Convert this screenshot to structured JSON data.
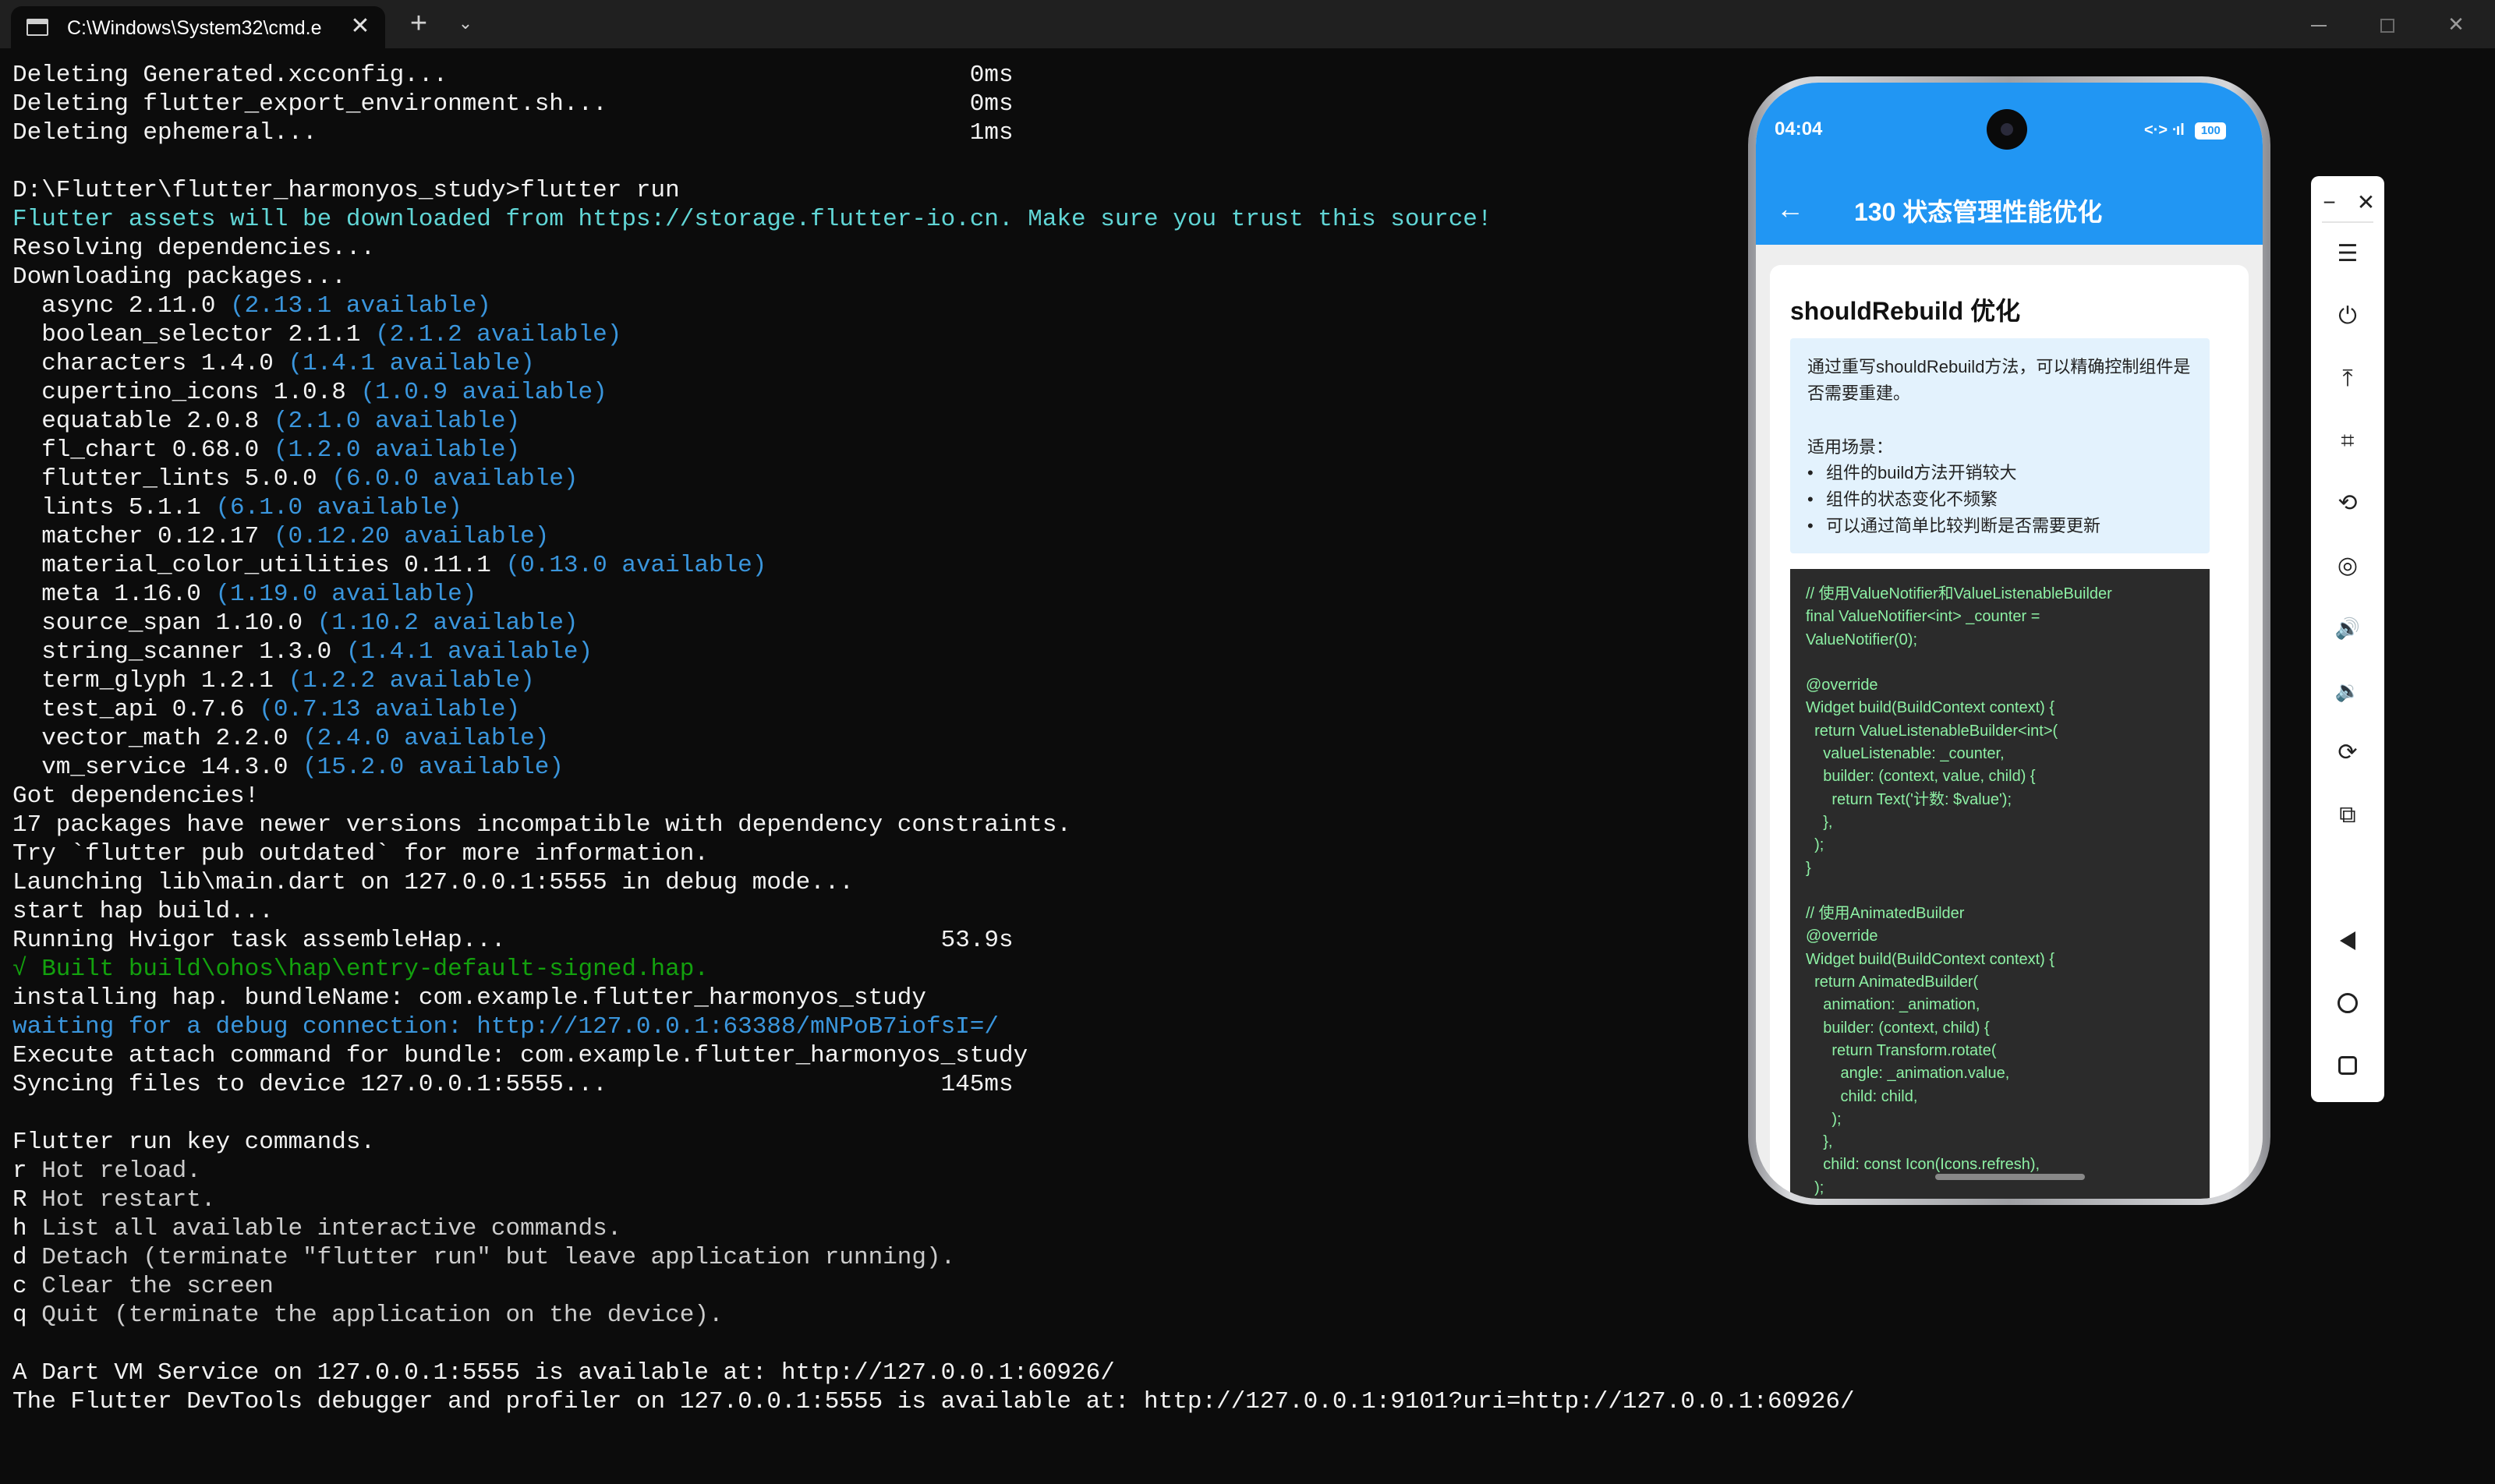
{
  "window": {
    "tab_title": "C:\\Windows\\System32\\cmd.e",
    "tab_close": "✕",
    "new_tab": "+",
    "tab_menu": "⌄",
    "close": "✕"
  },
  "console": {
    "lines": [
      [
        {
          "t": "Deleting Generated.xcconfig...                                    0ms",
          "s": "w"
        }
      ],
      [
        {
          "t": "Deleting flutter_export_environment.sh...                         0ms",
          "s": "w"
        }
      ],
      [
        {
          "t": "Deleting ephemeral...                                             1ms",
          "s": "w"
        }
      ],
      [
        {
          "t": "",
          "s": "w"
        }
      ],
      [
        {
          "t": "D:\\Flutter\\flutter_harmonyos_study>flutter run",
          "s": "w"
        }
      ],
      [
        {
          "t": "Flutter assets will be downloaded from https://storage.flutter-io.cn. Make sure you trust this source!",
          "s": "cy"
        }
      ],
      [
        {
          "t": "Resolving dependencies...",
          "s": "w"
        }
      ],
      [
        {
          "t": "Downloading packages...",
          "s": "w"
        }
      ],
      [
        {
          "t": "  async 2.11.0 ",
          "s": "w"
        },
        {
          "t": "(2.13.1 available)",
          "s": "c"
        }
      ],
      [
        {
          "t": "  boolean_selector 2.1.1 ",
          "s": "w"
        },
        {
          "t": "(2.1.2 available)",
          "s": "c"
        }
      ],
      [
        {
          "t": "  characters 1.4.0 ",
          "s": "w"
        },
        {
          "t": "(1.4.1 available)",
          "s": "c"
        }
      ],
      [
        {
          "t": "  cupertino_icons 1.0.8 ",
          "s": "w"
        },
        {
          "t": "(1.0.9 available)",
          "s": "c"
        }
      ],
      [
        {
          "t": "  equatable 2.0.8 ",
          "s": "w"
        },
        {
          "t": "(2.1.0 available)",
          "s": "c"
        }
      ],
      [
        {
          "t": "  fl_chart 0.68.0 ",
          "s": "w"
        },
        {
          "t": "(1.2.0 available)",
          "s": "c"
        }
      ],
      [
        {
          "t": "  flutter_lints 5.0.0 ",
          "s": "w"
        },
        {
          "t": "(6.0.0 available)",
          "s": "c"
        }
      ],
      [
        {
          "t": "  lints 5.1.1 ",
          "s": "w"
        },
        {
          "t": "(6.1.0 available)",
          "s": "c"
        }
      ],
      [
        {
          "t": "  matcher 0.12.17 ",
          "s": "w"
        },
        {
          "t": "(0.12.20 available)",
          "s": "c"
        }
      ],
      [
        {
          "t": "  material_color_utilities 0.11.1 ",
          "s": "w"
        },
        {
          "t": "(0.13.0 available)",
          "s": "c"
        }
      ],
      [
        {
          "t": "  meta 1.16.0 ",
          "s": "w"
        },
        {
          "t": "(1.19.0 available)",
          "s": "c"
        }
      ],
      [
        {
          "t": "  source_span 1.10.0 ",
          "s": "w"
        },
        {
          "t": "(1.10.2 available)",
          "s": "c"
        }
      ],
      [
        {
          "t": "  string_scanner 1.3.0 ",
          "s": "w"
        },
        {
          "t": "(1.4.1 available)",
          "s": "c"
        }
      ],
      [
        {
          "t": "  term_glyph 1.2.1 ",
          "s": "w"
        },
        {
          "t": "(1.2.2 available)",
          "s": "c"
        }
      ],
      [
        {
          "t": "  test_api 0.7.6 ",
          "s": "w"
        },
        {
          "t": "(0.7.13 available)",
          "s": "c"
        }
      ],
      [
        {
          "t": "  vector_math 2.2.0 ",
          "s": "w"
        },
        {
          "t": "(2.4.0 available)",
          "s": "c"
        }
      ],
      [
        {
          "t": "  vm_service 14.3.0 ",
          "s": "w"
        },
        {
          "t": "(15.2.0 available)",
          "s": "c"
        }
      ],
      [
        {
          "t": "Got dependencies!",
          "s": "w"
        }
      ],
      [
        {
          "t": "17 packages have newer versions incompatible with dependency constraints.",
          "s": "w"
        }
      ],
      [
        {
          "t": "Try `flutter pub outdated` for more information.",
          "s": "w"
        }
      ],
      [
        {
          "t": "Launching lib\\main.dart on 127.0.0.1:5555 in debug mode...",
          "s": "w"
        }
      ],
      [
        {
          "t": "start hap build...",
          "s": "w"
        }
      ],
      [
        {
          "t": "Running Hvigor task assembleHap...                              53.9s",
          "s": "w"
        }
      ],
      [
        {
          "t": "√ Built build\\ohos\\hap\\entry-default-signed.hap.",
          "s": "g"
        }
      ],
      [
        {
          "t": "installing hap. bundleName: com.example.flutter_harmonyos_study",
          "s": "w"
        }
      ],
      [
        {
          "t": "waiting for a debug connection: http://127.0.0.1:63388/mNPoB7iofsI=/",
          "s": "c"
        }
      ],
      [
        {
          "t": "Execute attach command for bundle: com.example.flutter_harmonyos_study",
          "s": "w"
        }
      ],
      [
        {
          "t": "Syncing files to device 127.0.0.1:5555...                       145ms",
          "s": "w"
        }
      ],
      [
        {
          "t": "",
          "s": "w"
        }
      ],
      [
        {
          "t": "Flutter run key commands.",
          "s": "w"
        }
      ],
      [
        {
          "t": "r",
          "s": "w"
        },
        {
          "t": " Hot reload.",
          "s": "g0"
        }
      ],
      [
        {
          "t": "R",
          "s": "w"
        },
        {
          "t": " Hot restart.",
          "s": "g0"
        }
      ],
      [
        {
          "t": "h",
          "s": "w"
        },
        {
          "t": " List all available interactive commands.",
          "s": "g0"
        }
      ],
      [
        {
          "t": "d",
          "s": "w"
        },
        {
          "t": " Detach (terminate \"flutter run\" but leave application running).",
          "s": "g0"
        }
      ],
      [
        {
          "t": "c",
          "s": "w"
        },
        {
          "t": " Clear the screen",
          "s": "g0"
        }
      ],
      [
        {
          "t": "q",
          "s": "w"
        },
        {
          "t": " Quit (terminate the application on the device).",
          "s": "g0"
        }
      ],
      [
        {
          "t": "",
          "s": "w"
        }
      ],
      [
        {
          "t": "A Dart VM Service on 127.0.0.1:5555 is available at: http://127.0.0.1:60926/",
          "s": "w"
        }
      ],
      [
        {
          "t": "The Flutter DevTools debugger and profiler on 127.0.0.1:5555 is available at: http://127.0.0.1:9101?uri=http://127.0.0.1:60926/",
          "s": "w"
        }
      ]
    ]
  },
  "phone": {
    "status": {
      "time": "04:04",
      "signal": "<·> ᐧıl",
      "battery": "100"
    },
    "appbar": {
      "back_icon": "←",
      "title": "130 状态管理性能优化"
    },
    "card": {
      "title": "shouldRebuild 优化",
      "description": "通过重写shouldRebuild方法，可以精确控制组件是否需要重建。",
      "scenario_title": "适用场景：",
      "bullets": [
        "组件的build方法开销较大",
        "组件的状态变化不频繁",
        "可以通过简单比较判断是否需要更新"
      ],
      "bullet_char": "•",
      "code_lines": [
        "// 使用ValueNotifier和ValueListenableBuilder",
        "final ValueNotifier<int> _counter =",
        "ValueNotifier(0);",
        "",
        "@override",
        "Widget build(BuildContext context) {",
        "  return ValueListenableBuilder<int>(",
        "    valueListenable: _counter,",
        "    builder: (context, value, child) {",
        "      return Text('计数: $value');",
        "    },",
        "  );",
        "}",
        "",
        "// 使用AnimatedBuilder",
        "@override",
        "Widget build(BuildContext context) {",
        "  return AnimatedBuilder(",
        "    animation: _animation,",
        "    builder: (context, child) {",
        "      return Transform.rotate(",
        "        angle: _animation.value,",
        "        child: child,",
        "      );",
        "    },",
        "    child: const Icon(Icons.refresh),",
        "  );"
      ]
    }
  },
  "toolbar": {
    "minimize": "−",
    "close": "✕",
    "menu": "☰",
    "power": "⏻",
    "pin_top": "⤒",
    "crop": "⌗",
    "rotate": "⟲",
    "screenshot": "◎",
    "volume_up": "🔊",
    "volume_down": "🔉",
    "rotate_device": "⟳",
    "multi_device": "⧉"
  },
  "colors": {
    "terminal_bg": "#0c0c0c",
    "terminal_text": "#cccccc",
    "terminal_highlight": "#3a96dd",
    "terminal_success": "#13a10e",
    "app_primary": "#2196f3",
    "code_text": "#8df0a4"
  }
}
